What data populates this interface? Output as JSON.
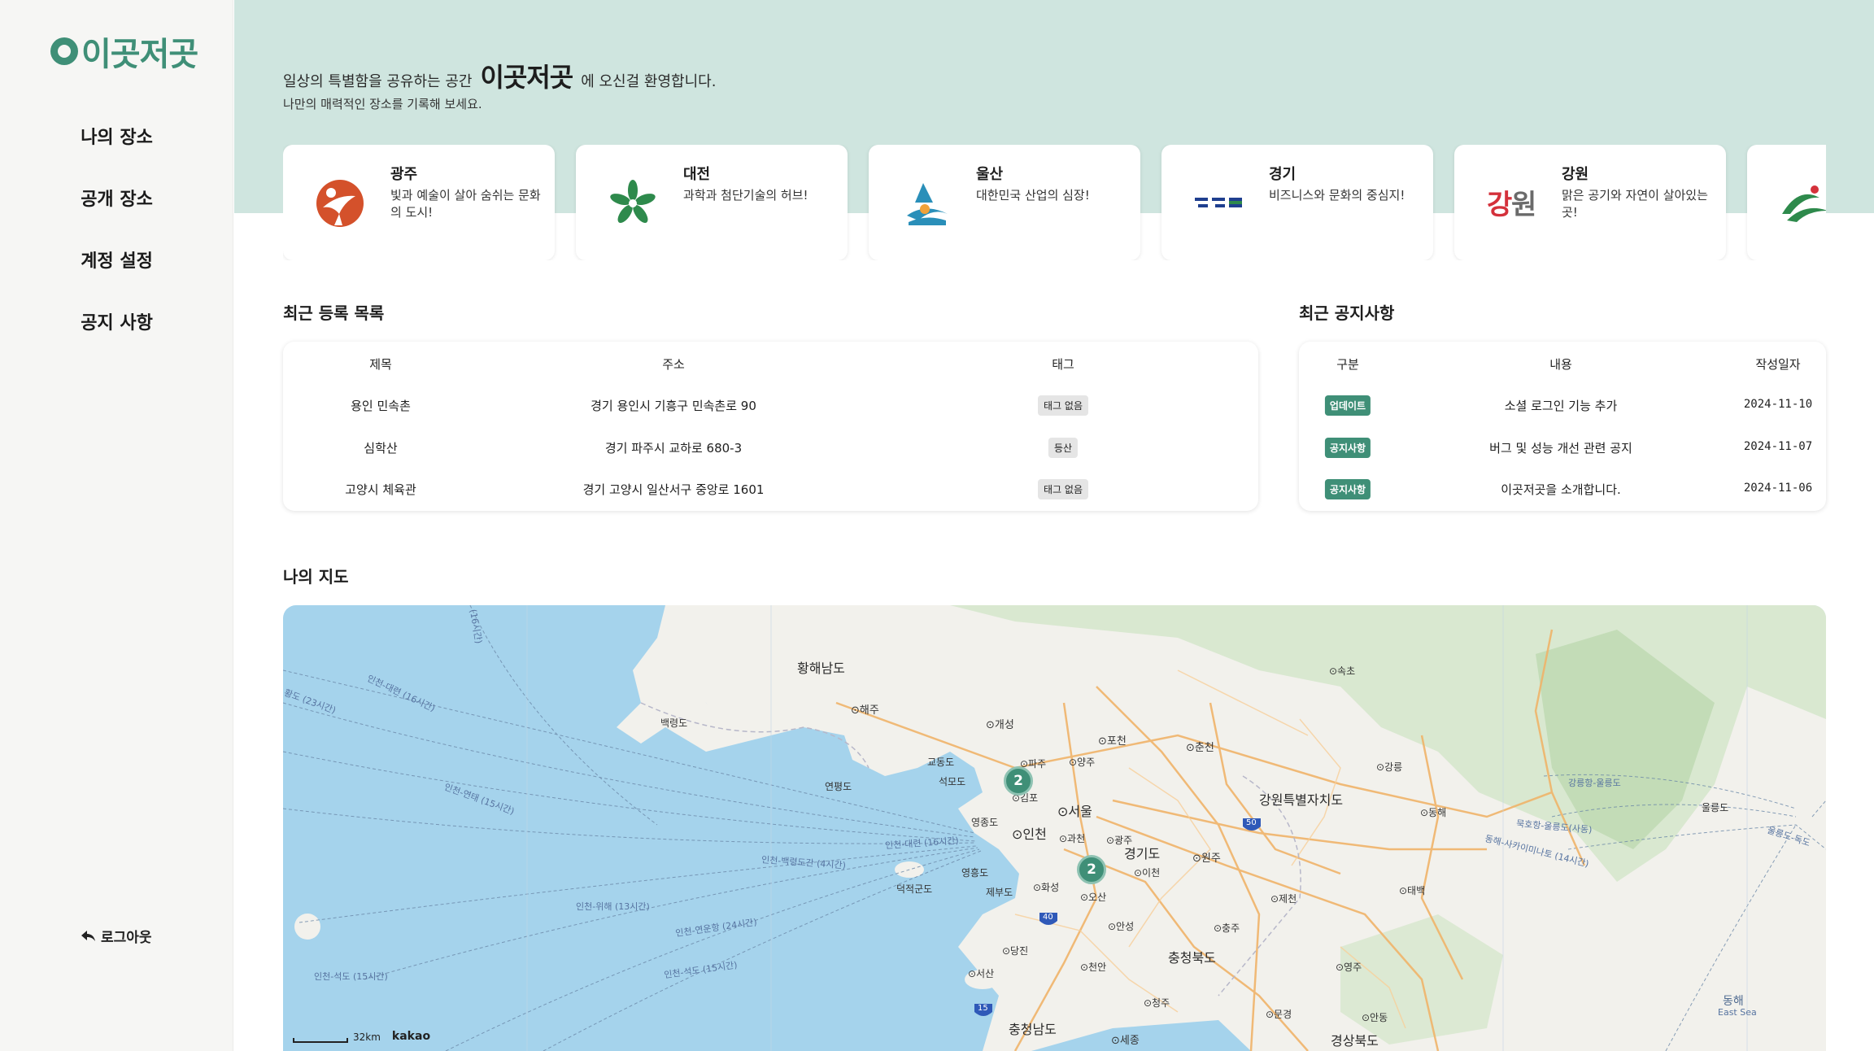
{
  "sidebar": {
    "logo_text": "이곳저곳",
    "nav": [
      "나의 장소",
      "공개 장소",
      "계정 설정",
      "공지 사항"
    ],
    "logout": "로그아웃"
  },
  "hero": {
    "welcome_prefix": "일상의 특별함을 공유하는 공간",
    "brand": "이곳저곳",
    "welcome_suffix": "에 오신걸 환영합니다.",
    "subtitle": "나만의 매력적인 장소를 기록해 보세요."
  },
  "regions": [
    {
      "name": "광주",
      "desc": "빛과 예술이 살아 숨쉬는 문화의 도시!",
      "emblem": "gwangju-emblem",
      "color": "#d4512b"
    },
    {
      "name": "대전",
      "desc": "과학과 첨단기술의 허브!",
      "emblem": "daejeon-emblem",
      "color": "#2e8a4c"
    },
    {
      "name": "울산",
      "desc": "대한민국 산업의 심장!",
      "emblem": "ulsan-emblem",
      "color": "#2a8fb9"
    },
    {
      "name": "경기",
      "desc": "비즈니스와 문화의 중심지!",
      "emblem": "gyeonggi-emblem",
      "color": "#1f3f8f"
    },
    {
      "name": "강원",
      "desc": "맑은 공기와 자연이 살아있는 곳!",
      "emblem": "gangwon-emblem",
      "color": "#d4313b"
    },
    {
      "name": "",
      "desc": "",
      "emblem": "jeonnam-emblem",
      "color": "#2e8a4c"
    }
  ],
  "recent": {
    "title": "최근 등록 목록",
    "headers": [
      "제목",
      "주소",
      "태그"
    ],
    "rows": [
      {
        "title": "용인 민속촌",
        "address": "경기 용인시 기흥구 민속촌로 90",
        "tag": "태그 없음"
      },
      {
        "title": "심학산",
        "address": "경기 파주시 교하로 680-3",
        "tag": "등산"
      },
      {
        "title": "고양시 체육관",
        "address": "경기 고양시 일산서구 중앙로 1601",
        "tag": "태그 없음"
      }
    ]
  },
  "notices": {
    "title": "최근 공지사항",
    "headers": [
      "구분",
      "내용",
      "작성일자"
    ],
    "rows": [
      {
        "type": "업데이트",
        "content": "소셜 로그인 기능 추가",
        "date": "2024-11-10"
      },
      {
        "type": "공지사항",
        "content": "버그 및 성능 개선 관련 공지",
        "date": "2024-11-07"
      },
      {
        "type": "공지사항",
        "content": "이곳저곳을 소개합니다.",
        "date": "2024-11-06"
      }
    ]
  },
  "map": {
    "title": "나의 지도",
    "clusters": [
      "2",
      "2"
    ],
    "labels": {
      "hwanghae": "황해남도",
      "haeju": "⊙해주",
      "gaeseong": "⊙개성",
      "baengnyeong": "백령도",
      "pocheon": "⊙포천",
      "chuncheon": "⊙춘천",
      "gyodong": "교동도",
      "seokmo": "석모도",
      "yeonpyeong": "연평도",
      "paju": "⊙파주",
      "yangju": "⊙양주",
      "gimpo": "⊙김포",
      "seoul": "⊙서울",
      "incheon": "⊙인천",
      "yeongjong": "영종도",
      "gwacheon": "⊙과천",
      "gwangju_g": "⊙광주",
      "gyeonggi": "경기도",
      "wonju": "⊙원주",
      "icheon": "⊙이천",
      "yeongheung": "영흥도",
      "deokjeok": "덕적군도",
      "jebu": "제부도",
      "hwaseong": "⊙화성",
      "osan": "⊙오산",
      "anseong": "⊙안성",
      "chungju": "⊙충주",
      "jecheon": "⊙제천",
      "dangjin": "⊙당진",
      "cheonan": "⊙천안",
      "seosan": "⊙서산",
      "chungbuk": "충청북도",
      "cheongju": "⊙청주",
      "yeongju": "⊙영주",
      "mungyeong": "⊙문경",
      "andong": "⊙안동",
      "chungnam": "충청남도",
      "sejong": "⊙세종",
      "gyeongbuk": "경상북도",
      "gangwon": "강원특별자치도",
      "gangneung": "⊙강릉",
      "donghae": "⊙동해",
      "taebaek": "⊙태백",
      "sokcho": "⊙속초",
      "ulleung": "울릉도",
      "eastsea": "동해",
      "eastsea_en": "East Sea",
      "route1": "인천-대련 (16시간)",
      "route2": "인천-연태 (15시간)",
      "route3": "인천-백령도간 (4시간)",
      "route4": "인천-대련 (16시간)",
      "route5": "인천-위해 (13시간)",
      "route6": "인천-연운항 (24시간)",
      "route7": "인천-석도 (15시간)",
      "route8": "인천-석도 (15시간)",
      "route9": "(16시간)",
      "route10": "황도 (23시간)",
      "route11": "강릉항-울릉도",
      "route12": "묵호항-울릉도(사동)",
      "route13": "동해-사카이미나토 (14시간)",
      "route14": "울릉도-독도",
      "hw50": "50",
      "hw40": "40",
      "hw15": "15"
    },
    "scale": "32km",
    "provider": "kakao",
    "colors": {
      "sea": "#a5d3ec",
      "land": "#f2f1ec",
      "forest": "#cfe3c8",
      "road": "#f0b46a"
    }
  }
}
